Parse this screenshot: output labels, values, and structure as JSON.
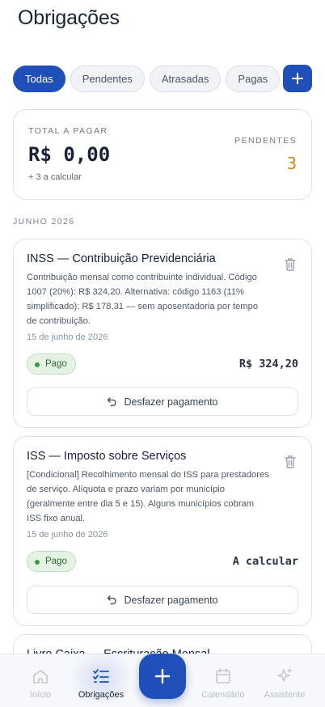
{
  "header": {
    "title": "Obrigações"
  },
  "filters": {
    "chips": [
      "Todas",
      "Pendentes",
      "Atrasadas",
      "Pagas"
    ],
    "add_icon": "plus-icon"
  },
  "summary": {
    "label": "TOTAL A PAGAR",
    "amount": "R$ 0,00",
    "sub": "+ 3 a calcular",
    "pending_label": "PENDENTES",
    "pending_count": "3"
  },
  "month": "JUNHO 2026",
  "cards": [
    {
      "title": "INSS — Contribuição Previdenciária",
      "description": "Contribuição mensal como contribuinte individual. Código 1007 (20%): R$ 324,20. Alternativa: código 1163 (11% simplificado): R$ 178,31 — sem aposentadoria por tempo de contribuição.",
      "date": "15 de junho de 2026",
      "status": "Pago",
      "value": "R$ 324,20",
      "undo_label": "Desfazer pagamento"
    },
    {
      "title": "ISS — Imposto sobre Serviços",
      "description": "[Condicional] Recolhimento mensal do ISS para prestadores de serviço. Alíquota e prazo variam por município (geralmente entre dia 5 e 15). Alguns municípios cobram ISS fixo anual.",
      "date": "15 de junho de 2026",
      "status": "Pago",
      "value": "A calcular",
      "undo_label": "Desfazer pagamento"
    },
    {
      "title": "Livro Caixa — Escrituração Mensal"
    }
  ],
  "tabbar": {
    "items": [
      {
        "label": "Início",
        "icon": "home-icon"
      },
      {
        "label": "Obrigações",
        "icon": "checklist-icon"
      },
      {
        "label": "Calendário",
        "icon": "calendar-icon"
      },
      {
        "label": "Assistente",
        "icon": "sparkle-icon"
      }
    ],
    "fab_icon": "plus-icon"
  },
  "colors": {
    "accent": "#1f4fb8",
    "pending": "#c98a12",
    "paid_bg": "#e4f3e4",
    "paid_text": "#2e6b31"
  }
}
